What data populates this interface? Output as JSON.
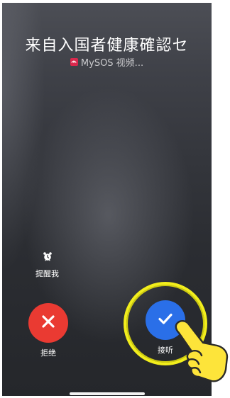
{
  "call": {
    "caller_name": "来自入国者健康確認セ",
    "source_app": "MySOS 视频..."
  },
  "actions": {
    "remind_label": "提醒我",
    "decline_label": "拒绝",
    "accept_label": "接听"
  },
  "icons": {
    "app_badge": "mysos-app-icon",
    "remind": "alarm-clock-icon",
    "decline": "x-icon",
    "accept": "checkmark-icon",
    "pointer": "pointing-hand-icon"
  },
  "colors": {
    "decline": "#ea3a32",
    "accept": "#2a6fe8",
    "highlight_ring": "#f2ee1c",
    "app_badge": "#d9284d"
  }
}
